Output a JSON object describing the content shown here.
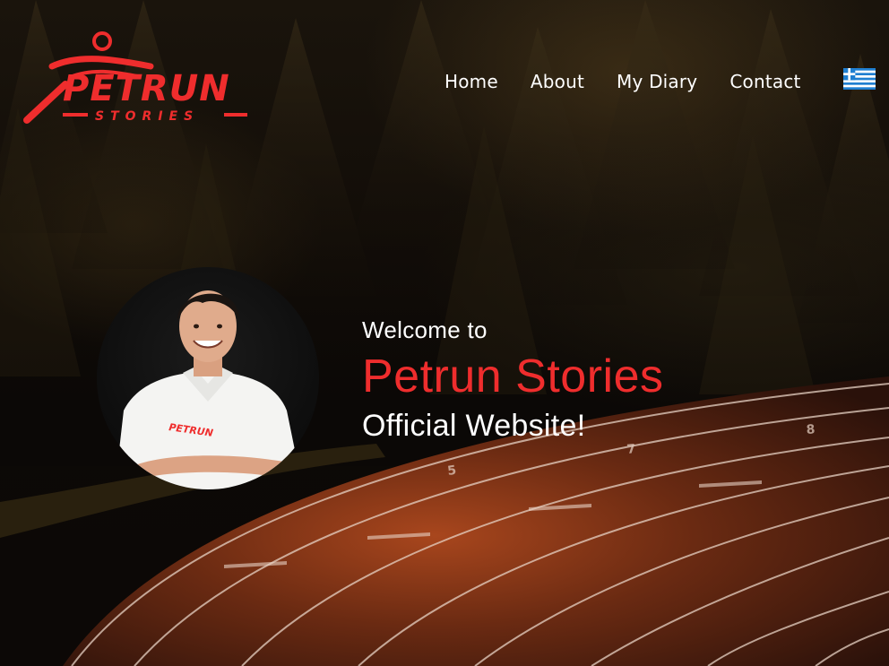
{
  "header": {
    "logo": {
      "main_text": "PETRUN",
      "sub_text": "STORIES",
      "color": "#ef2d2d"
    },
    "nav": {
      "items": [
        {
          "label": "Home"
        },
        {
          "label": "About"
        },
        {
          "label": "My Diary"
        },
        {
          "label": "Contact"
        }
      ]
    },
    "language_flag": "greek-flag-icon"
  },
  "hero": {
    "welcome": "Welcome to",
    "title": "Petrun Stories",
    "subtitle": "Official Website!",
    "title_color": "#ef2d2d",
    "portrait": {
      "shirt_logo_text": "PETRUN"
    }
  }
}
